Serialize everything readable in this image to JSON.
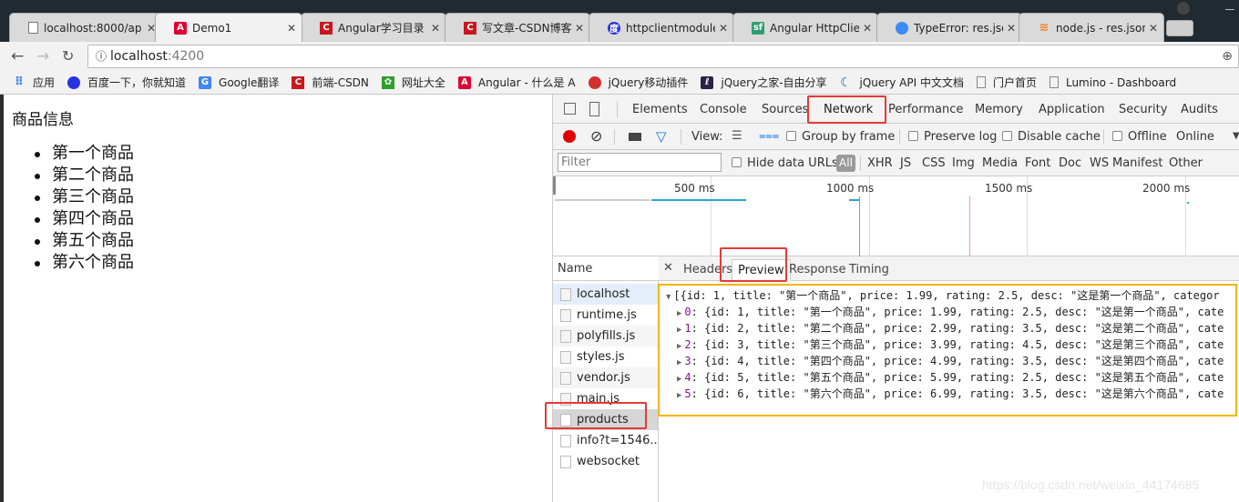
{
  "browser": {
    "tabs": [
      {
        "title": "localhost:8000/ap",
        "icon": "page-icon",
        "active": false
      },
      {
        "title": "Demo1",
        "icon": "angular-icon",
        "active": true
      },
      {
        "title": "Angular学习目录",
        "icon": "csdn-icon",
        "active": false
      },
      {
        "title": "写文章-CSDN博客",
        "icon": "csdn-icon",
        "active": false
      },
      {
        "title": "httpclientmodule",
        "icon": "baidu-icon",
        "active": false
      },
      {
        "title": "Angular HttpClie",
        "icon": "segmentfault-icon",
        "active": false
      },
      {
        "title": "TypeError: res.jso",
        "icon": "chat-icon",
        "active": false
      },
      {
        "title": "node.js - res.json",
        "icon": "stackoverflow-icon",
        "active": false
      }
    ],
    "address": {
      "host": "localhost",
      "port": ":4200"
    },
    "bookmarks": [
      {
        "label": "应用",
        "icon": "apps-icon",
        "color": "#4285f4"
      },
      {
        "label": "百度一下，你就知道",
        "icon": "baidu-icon",
        "color": "#2932e1"
      },
      {
        "label": "Google翻译",
        "icon": "google-translate-icon",
        "color": "#4285f4"
      },
      {
        "label": "前端-CSDN",
        "icon": "csdn-icon",
        "color": "#c9171e"
      },
      {
        "label": "网址大全",
        "icon": "360-icon",
        "color": "#2e9e2e"
      },
      {
        "label": "Angular - 什么是 A",
        "icon": "angular-icon",
        "color": "#dd0031"
      },
      {
        "label": "jQuery移动插件",
        "icon": "jquery-plugin-icon",
        "color": "#d32f2f"
      },
      {
        "label": "jQuery之家-自由分享",
        "icon": "jquery-home-icon",
        "color": "#2b2246"
      },
      {
        "label": "jQuery API 中文文档",
        "icon": "jquery-icon",
        "color": "#0769ad"
      },
      {
        "label": "门户首页",
        "icon": "page-icon",
        "color": "#888888"
      },
      {
        "label": "Lumino - Dashboard",
        "icon": "page-icon",
        "color": "#888888"
      }
    ]
  },
  "page": {
    "heading": "商品信息",
    "products": [
      "第一个商品",
      "第二个商品",
      "第三个商品",
      "第四个商品",
      "第五个商品",
      "第六个商品"
    ]
  },
  "devtools": {
    "tabs": [
      "Elements",
      "Console",
      "Sources",
      "Network",
      "Performance",
      "Memory",
      "Application",
      "Security",
      "Audits"
    ],
    "active_tab": "Network",
    "toolbar": {
      "view_label": "View:",
      "group_by_frame": "Group by frame",
      "preserve_log": "Preserve log",
      "disable_cache": "Disable cache",
      "offline": "Offline",
      "throttle": "Online"
    },
    "filter": {
      "placeholder": "Filter",
      "hide_data_urls": "Hide data URLs",
      "types": [
        "All",
        "XHR",
        "JS",
        "CSS",
        "Img",
        "Media",
        "Font",
        "Doc",
        "WS",
        "Manifest",
        "Other"
      ],
      "active_type": "All"
    },
    "timeline": {
      "ticks": [
        "500 ms",
        "1000 ms",
        "1500 ms",
        "2000 ms"
      ]
    },
    "requests": {
      "header": "Name",
      "items": [
        "localhost",
        "runtime.js",
        "polyfills.js",
        "styles.js",
        "vendor.js",
        "main.js",
        "products",
        "info?t=1546...",
        "websocket"
      ],
      "selected": "products"
    },
    "detail": {
      "tabs": [
        "Headers",
        "Preview",
        "Response",
        "Timing"
      ],
      "active_tab": "Preview",
      "summary": "[{id: 1, title: \"第一个商品\", price: 1.99, rating: 2.5, desc: \"这是第一个商品\", categor",
      "rows": [
        {
          "index": "0",
          "text": "{id: 1, title: \"第一个商品\", price: 1.99, rating: 2.5, desc: \"这是第一个商品\", cate"
        },
        {
          "index": "1",
          "text": "{id: 2, title: \"第二个商品\", price: 2.99, rating: 3.5, desc: \"这是第二个商品\", cate"
        },
        {
          "index": "2",
          "text": "{id: 3, title: \"第三个商品\", price: 3.99, rating: 4.5, desc: \"这是第三个商品\", cate"
        },
        {
          "index": "3",
          "text": "{id: 4, title: \"第四个商品\", price: 4.99, rating: 3.5, desc: \"这是第四个商品\", cate"
        },
        {
          "index": "4",
          "text": "{id: 5, title: \"第五个商品\", price: 5.99, rating: 2.5, desc: \"这是第五个商品\", cate"
        },
        {
          "index": "5",
          "text": "{id: 6, title: \"第六个商品\", price: 6.99, rating: 3.5, desc: \"这是第六个商品\", cate"
        }
      ]
    }
  },
  "watermark": "https://blog.csdn.net/weixin_44174685"
}
